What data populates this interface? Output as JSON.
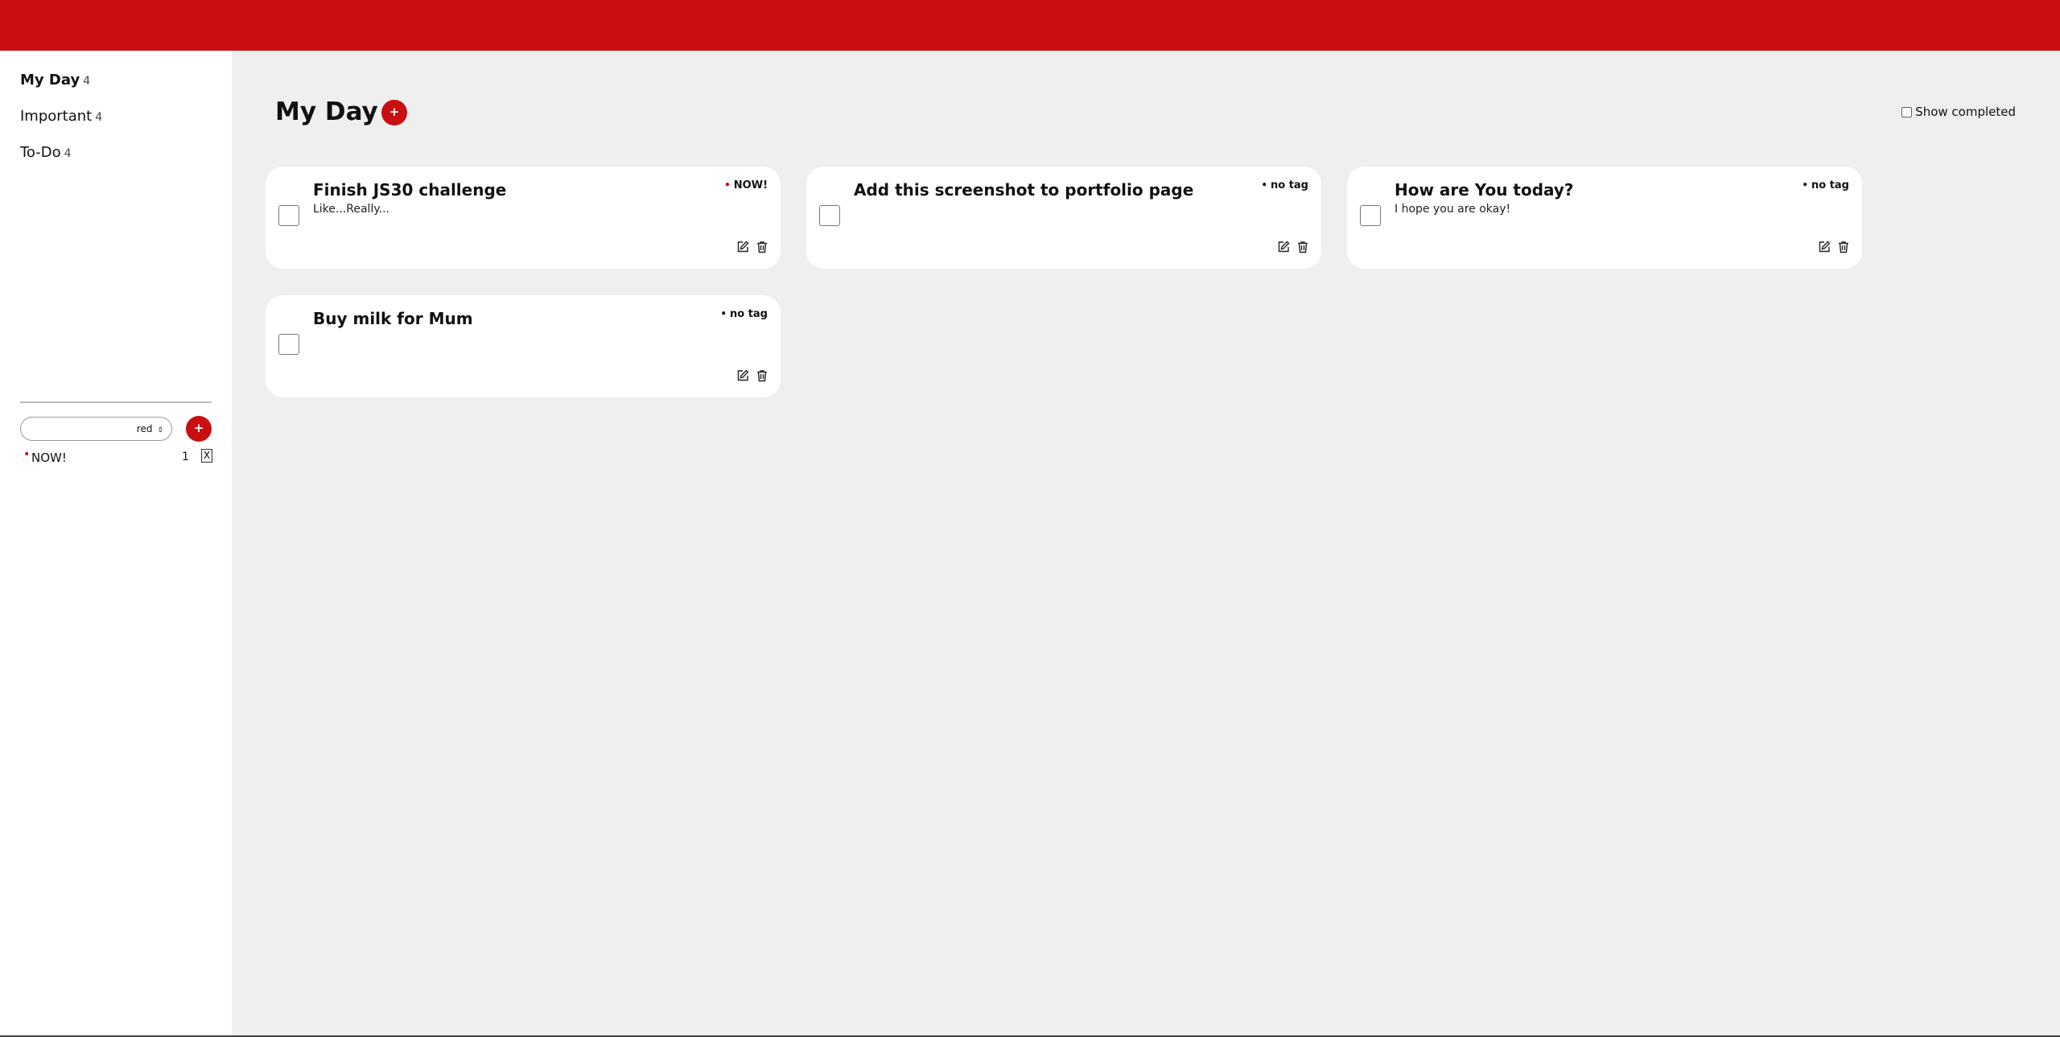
{
  "sidebar": {
    "nav": [
      {
        "label": "My Day",
        "count": "4"
      },
      {
        "label": "Important",
        "count": "4"
      },
      {
        "label": "To-Do",
        "count": "4"
      }
    ],
    "tag_form": {
      "input_value": "",
      "color_value": "red",
      "add_label": "+"
    },
    "tags": [
      {
        "name": "NOW!",
        "count": "1",
        "remove_label": "X",
        "color": "#c90f11"
      }
    ]
  },
  "main": {
    "title": "My Day",
    "add_label": "+",
    "show_completed_label": "Show completed",
    "show_completed_checked": false
  },
  "tasks": [
    {
      "title": "Finish JS30 challenge",
      "description": "Like...Really...",
      "tag": "NOW!",
      "tag_color": "#c90f11"
    },
    {
      "title": "Add this screenshot to portfolio page",
      "description": "",
      "tag": "no tag",
      "tag_color": "#222222"
    },
    {
      "title": "How are You today?",
      "description": "I hope you are okay!",
      "tag": "no tag",
      "tag_color": "#222222"
    },
    {
      "title": "Buy milk for Mum",
      "description": "",
      "tag": "no tag",
      "tag_color": "#222222"
    }
  ],
  "colors": {
    "brand": "#c90f11",
    "background": "#efefef",
    "card": "#ffffff"
  }
}
